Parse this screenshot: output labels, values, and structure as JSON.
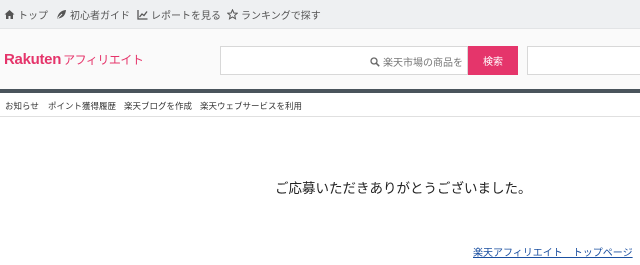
{
  "topnav": {
    "items": [
      {
        "label": "トップ",
        "icon": "home-icon"
      },
      {
        "label": "初心者ガイド",
        "icon": "leaf-icon"
      },
      {
        "label": "レポートを見る",
        "icon": "chart-icon"
      },
      {
        "label": "ランキングで探す",
        "icon": "star-icon"
      }
    ]
  },
  "header": {
    "logo_main": "Rakuten",
    "logo_sub": "アフィリエイト",
    "search": {
      "placeholder": "楽天市場の商品を",
      "button_label": "検索"
    }
  },
  "subnav": {
    "items": [
      "お知らせ",
      "ポイント獲得履歴",
      "楽天ブログを作成",
      "楽天ウェブサービスを利用"
    ]
  },
  "main": {
    "message": "ご応募いただきありがとうございました。",
    "top_link": "楽天アフィリエイト　トップページ"
  },
  "colors": {
    "brand": "#e5356b",
    "dark_bar": "#4a545c",
    "link": "#1a4fa0"
  }
}
